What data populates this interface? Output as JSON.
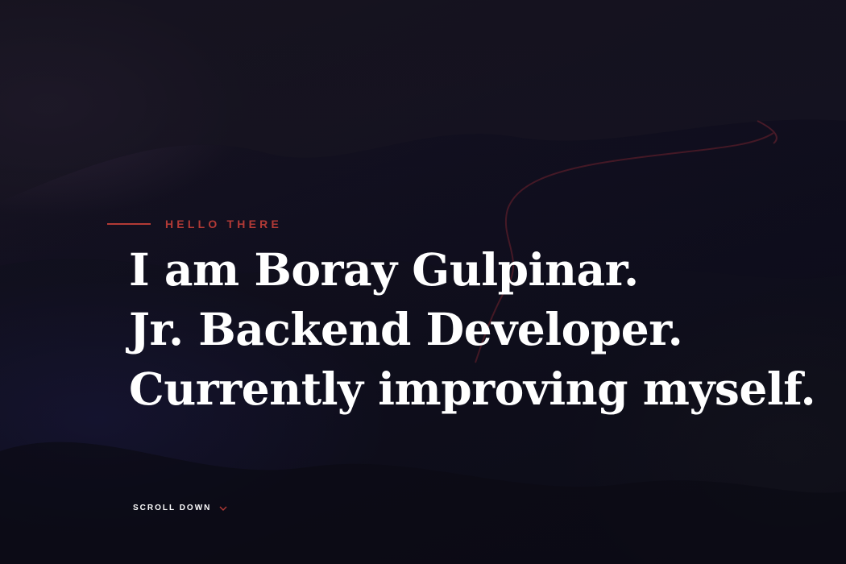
{
  "hero": {
    "kicker": "HELLO THERE",
    "lines": [
      "I am Boray Gulpinar.",
      "Jr. Backend Developer.",
      "Currently improving myself."
    ],
    "scroll_label": "SCROLL DOWN"
  },
  "colors": {
    "accent": "#b33a35",
    "headline": "#ffffff",
    "background": "#121020"
  },
  "icons": {
    "scroll": "chevron-down-icon"
  }
}
